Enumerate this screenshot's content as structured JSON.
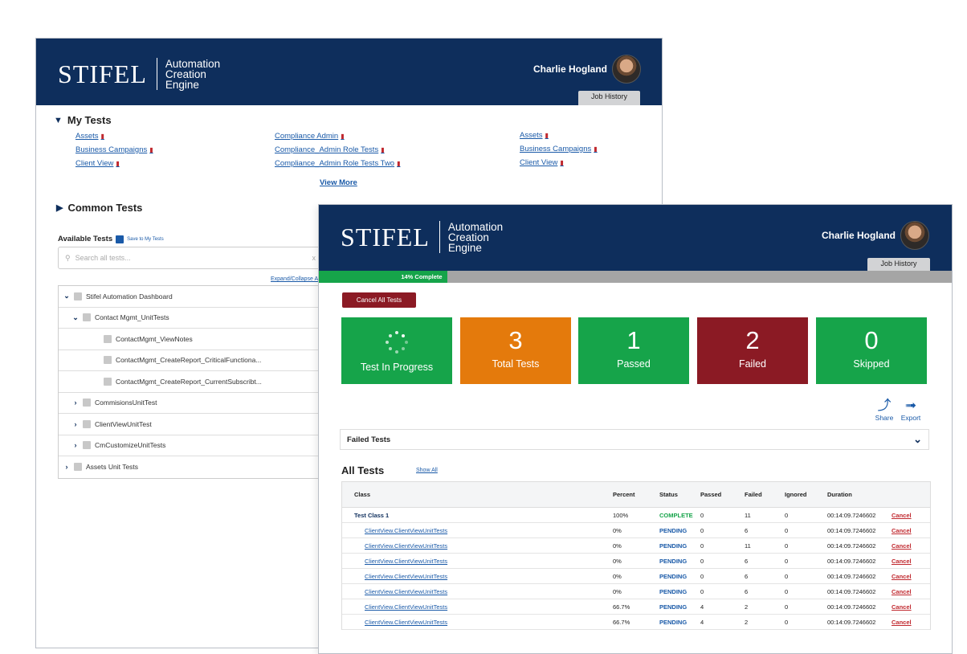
{
  "app": {
    "brand": "STIFEL",
    "tagline": [
      "Automation",
      "Creation",
      "Engine"
    ],
    "user_name": "Charlie Hogland",
    "job_history": "Job History"
  },
  "back_window": {
    "my_tests": {
      "title": "My Tests",
      "col1": [
        "Assets",
        "Business Campaigns",
        "Client View"
      ],
      "col2": [
        "Compliance Admin",
        "Compliance_Admin Role Tests",
        "Compliance_Admin Role Tests Two"
      ],
      "col3": [
        "Assets",
        "Business Campaigns",
        "Client View"
      ],
      "view_more": "View More"
    },
    "common_tests": {
      "title": "Common Tests"
    },
    "available_tests": {
      "label": "Available Tests",
      "save_link": "Save to My Tests",
      "search_placeholder": "Search all tests...",
      "clear": "x",
      "expand_collapse": "Expand/Collapse All"
    },
    "tree": [
      {
        "label": "Stifel Automation Dashboard",
        "level": 0,
        "state": "open"
      },
      {
        "label": "Contact Mgmt_UnitTests",
        "level": 1,
        "state": "open"
      },
      {
        "label": "ContactMgmt_ViewNotes",
        "level": 2,
        "state": "leaf"
      },
      {
        "label": "ContactMgmt_CreateReport_CriticalFunctiona...",
        "level": 2,
        "state": "leaf"
      },
      {
        "label": "ContactMgmt_CreateReport_CurrentSubscribt...",
        "level": 2,
        "state": "leaf"
      },
      {
        "label": "CommisionsUnitTest",
        "level": 1,
        "state": "closed"
      },
      {
        "label": "ClientViewUnitTest",
        "level": 1,
        "state": "closed"
      },
      {
        "label": "CmCustomizeUnitTests",
        "level": 1,
        "state": "closed"
      },
      {
        "label": "Assets Unit Tests",
        "level": 0,
        "state": "closed"
      }
    ]
  },
  "front_window": {
    "progress": {
      "label": "14% Complete",
      "value": 0.14
    },
    "cancel_all": "Cancel All Tests",
    "tiles": [
      {
        "key": "progress",
        "number": "",
        "label": "Test In Progress",
        "color": "#16a44a"
      },
      {
        "key": "total",
        "number": "3",
        "label": "Total Tests",
        "color": "#e47a0c"
      },
      {
        "key": "passed",
        "number": "1",
        "label": "Passed",
        "color": "#16a44a"
      },
      {
        "key": "failed",
        "number": "2",
        "label": "Failed",
        "color": "#8b1a24"
      },
      {
        "key": "skipped",
        "number": "0",
        "label": "Skipped",
        "color": "#16a44a"
      }
    ],
    "share": "Share",
    "export": "Export",
    "failed_tests": "Failed Tests",
    "all_tests": "All Tests",
    "show_all": "Show All",
    "columns": [
      "Class",
      "Percent",
      "Status",
      "Passed",
      "Failed",
      "Ignored",
      "Duration"
    ],
    "rows": [
      {
        "class": "Test Class 1",
        "group": true,
        "percent": "100%",
        "status": "COMPLETE",
        "passed": "0",
        "failed": "11",
        "ignored": "0",
        "duration": "00:14:09.7246602",
        "action": "Cancel"
      },
      {
        "class": "ClientView.ClientViewUnitTests",
        "group": false,
        "percent": "0%",
        "status": "PENDING",
        "passed": "0",
        "failed": "6",
        "ignored": "0",
        "duration": "00:14:09.7246602",
        "action": "Cancel"
      },
      {
        "class": "ClientView.ClientViewUnitTests",
        "group": false,
        "percent": "0%",
        "status": "PENDING",
        "passed": "0",
        "failed": "11",
        "ignored": "0",
        "duration": "00:14:09.7246602",
        "action": "Cancel"
      },
      {
        "class": "ClientView.ClientViewUnitTests",
        "group": false,
        "percent": "0%",
        "status": "PENDING",
        "passed": "0",
        "failed": "6",
        "ignored": "0",
        "duration": "00:14:09.7246602",
        "action": "Cancel"
      },
      {
        "class": "ClientView.ClientViewUnitTests",
        "group": false,
        "percent": "0%",
        "status": "PENDING",
        "passed": "0",
        "failed": "6",
        "ignored": "0",
        "duration": "00:14:09.7246602",
        "action": "Cancel"
      },
      {
        "class": "ClientView.ClientViewUnitTests",
        "group": false,
        "percent": "0%",
        "status": "PENDING",
        "passed": "0",
        "failed": "6",
        "ignored": "0",
        "duration": "00:14:09.7246602",
        "action": "Cancel"
      },
      {
        "class": "ClientView.ClientViewUnitTests",
        "group": false,
        "percent": "66.7%",
        "status": "PENDING",
        "passed": "4",
        "failed": "2",
        "ignored": "0",
        "duration": "00:14:09.7246602",
        "action": "Cancel"
      },
      {
        "class": "ClientView.ClientViewUnitTests",
        "group": false,
        "percent": "66.7%",
        "status": "PENDING",
        "passed": "4",
        "failed": "2",
        "ignored": "0",
        "duration": "00:14:09.7246602",
        "action": "Cancel"
      }
    ]
  }
}
